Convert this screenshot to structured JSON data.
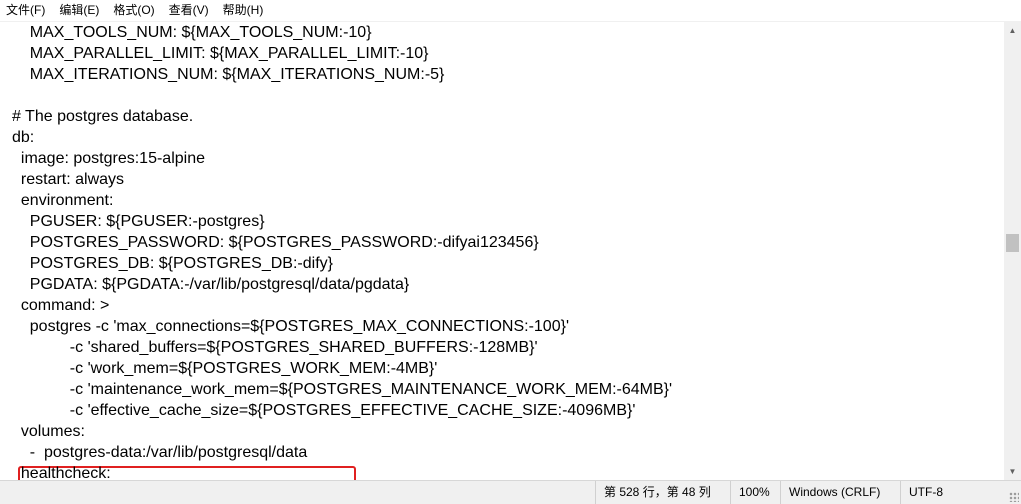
{
  "menu": {
    "items": [
      "文件(F)",
      "编辑(E)",
      "格式(O)",
      "查看(V)",
      "帮助(H)"
    ]
  },
  "editor": {
    "lines": [
      "    MAX_TOOLS_NUM: ${MAX_TOOLS_NUM:-10}",
      "    MAX_PARALLEL_LIMIT: ${MAX_PARALLEL_LIMIT:-10}",
      "    MAX_ITERATIONS_NUM: ${MAX_ITERATIONS_NUM:-5}",
      "",
      "# The postgres database.",
      "db:",
      "  image: postgres:15-alpine",
      "  restart: always",
      "  environment:",
      "    PGUSER: ${PGUSER:-postgres}",
      "    POSTGRES_PASSWORD: ${POSTGRES_PASSWORD:-difyai123456}",
      "    POSTGRES_DB: ${POSTGRES_DB:-dify}",
      "    PGDATA: ${PGDATA:-/var/lib/postgresql/data/pgdata}",
      "  command: >",
      "    postgres -c 'max_connections=${POSTGRES_MAX_CONNECTIONS:-100}'",
      "             -c 'shared_buffers=${POSTGRES_SHARED_BUFFERS:-128MB}'",
      "             -c 'work_mem=${POSTGRES_WORK_MEM:-4MB}'",
      "             -c 'maintenance_work_mem=${POSTGRES_MAINTENANCE_WORK_MEM:-64MB}'",
      "             -c 'effective_cache_size=${POSTGRES_EFFECTIVE_CACHE_SIZE:-4096MB}'",
      "  volumes:",
      "    -  postgres-data:/var/lib/postgresql/data",
      "  healthcheck:"
    ],
    "highlighted_line": 20,
    "highlight_color": "#e02020"
  },
  "status": {
    "position": "第 528 行，第 48 列",
    "zoom": "100%",
    "line_ending": "Windows (CRLF)",
    "encoding": "UTF-8"
  },
  "scrollbar": {
    "up_icon": "▲",
    "down_icon": "▼"
  }
}
